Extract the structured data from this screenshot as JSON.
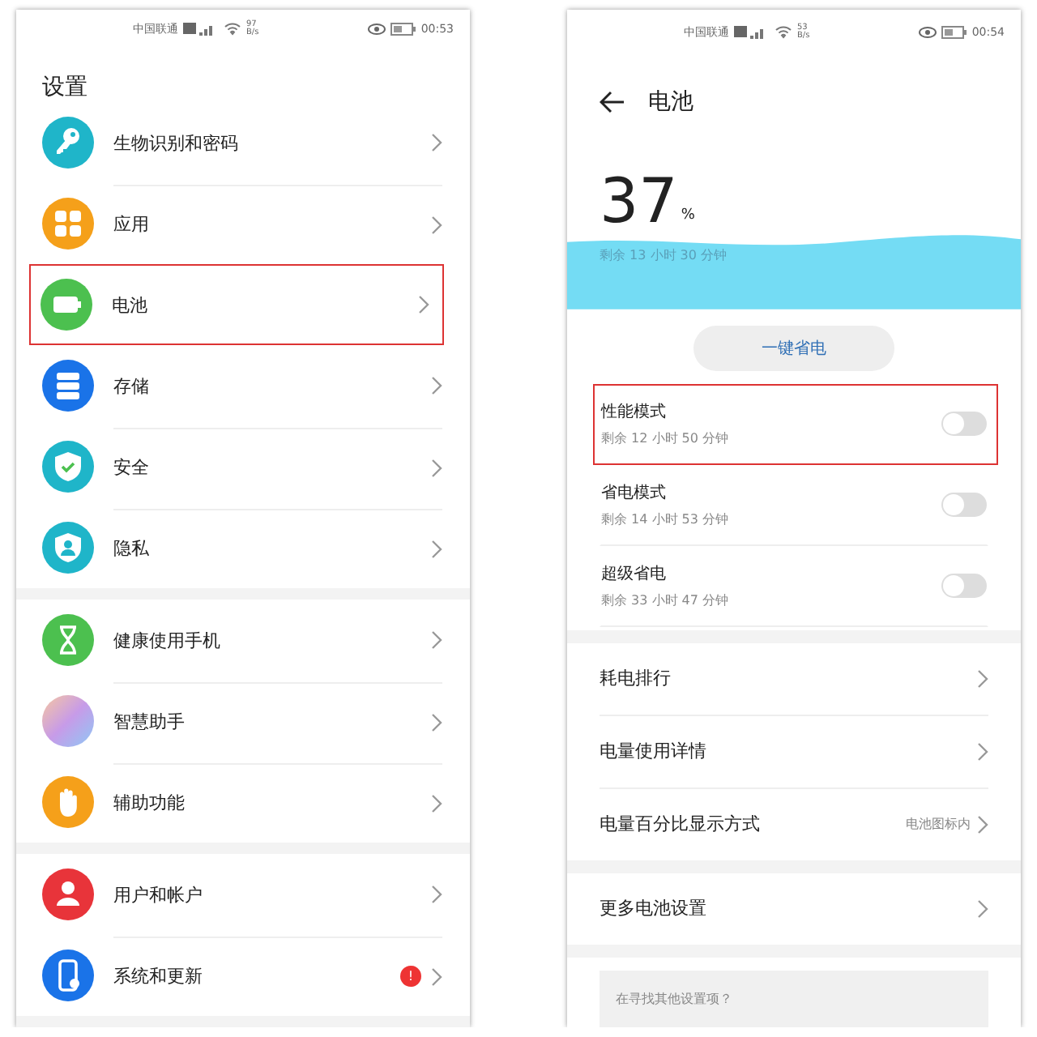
{
  "screens": [
    {
      "status_bar": {
        "carrier": "中国联通",
        "speed": "97\nB/s",
        "time": "00:53"
      },
      "title": "设置",
      "groups": [
        [
          {
            "label": "生物识别和密码",
            "kind": "key",
            "highlighted": false
          },
          {
            "label": "应用",
            "kind": "apps",
            "highlighted": false
          },
          {
            "label": "电池",
            "kind": "battery",
            "highlighted": true
          },
          {
            "label": "存储",
            "kind": "storage",
            "highlighted": false
          },
          {
            "label": "安全",
            "kind": "shield",
            "highlighted": false
          },
          {
            "label": "隐私",
            "kind": "privacy",
            "highlighted": false
          }
        ],
        [
          {
            "label": "健康使用手机",
            "kind": "hourglass",
            "highlighted": false
          },
          {
            "label": "智慧助手",
            "kind": "assistant",
            "highlighted": false
          },
          {
            "label": "辅助功能",
            "kind": "hand",
            "highlighted": false
          }
        ],
        [
          {
            "label": "用户和帐户",
            "kind": "user",
            "highlighted": false
          },
          {
            "label": "系统和更新",
            "kind": "phone",
            "highlighted": false,
            "badge": "!"
          }
        ]
      ]
    },
    {
      "status_bar": {
        "carrier": "中国联通",
        "speed": "53\nB/s",
        "time": "00:54"
      },
      "title": "电池",
      "battery": {
        "percent": "37",
        "unit": "%",
        "remaining": "剩余 13 小时 30 分钟"
      },
      "save_button": "一键省电",
      "modes": [
        {
          "label": "性能模式",
          "sub": "剩余 12 小时 50 分钟",
          "on": false,
          "highlighted": true
        },
        {
          "label": "省电模式",
          "sub": "剩余 14 小时 53 分钟",
          "on": false,
          "highlighted": false
        },
        {
          "label": "超级省电",
          "sub": "剩余 33 小时 47 分钟",
          "on": false,
          "highlighted": false
        }
      ],
      "links": [
        [
          {
            "label": "耗电排行"
          },
          {
            "label": "电量使用详情"
          },
          {
            "label": "电量百分比显示方式",
            "value": "电池图标内"
          }
        ],
        [
          {
            "label": "更多电池设置"
          }
        ]
      ],
      "search_hint": "在寻找其他设置项？"
    }
  ]
}
